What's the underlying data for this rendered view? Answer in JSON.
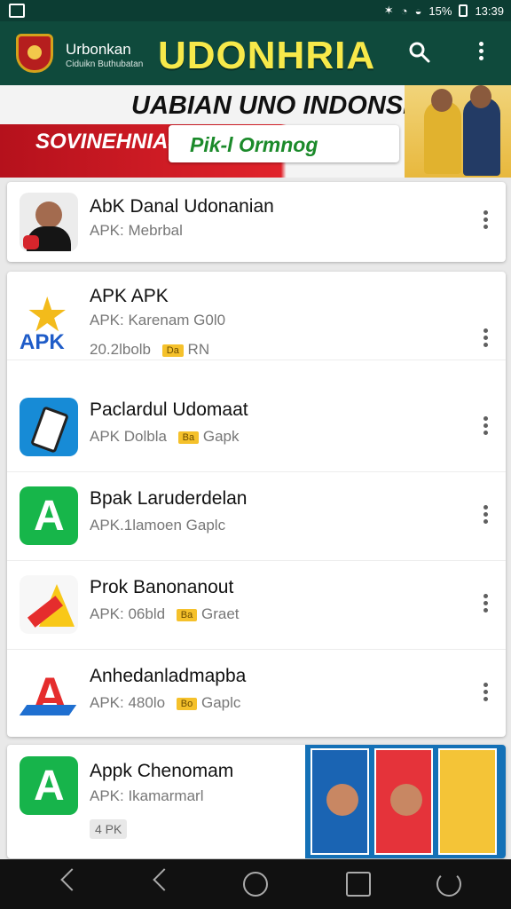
{
  "status": {
    "time": "13:39",
    "battery_text": "15%"
  },
  "header": {
    "brand_main": "Urbonkan",
    "brand_sub": "Ciduikn Buthubatan",
    "title": "UDONHRIA"
  },
  "banner": {
    "title": "UABIAN UNO INDONSIAI",
    "sub": "SOVINEHNIAS!",
    "input_text": "Pik-l Ormnog"
  },
  "featured": {
    "name": "AbK Danal Udonanian",
    "meta": "APK: Mebrbal"
  },
  "apps": [
    {
      "name": "APK APK",
      "meta": "APK: Karenam G0l0",
      "meta2": "20.2lbolb",
      "tag": "Da",
      "tag2": "RN"
    },
    {
      "name": "Paclardul Udomaat",
      "meta": "APK Dolbla",
      "tag": "Ba",
      "tag2": "Gapk"
    },
    {
      "name": "Bpak Laruderdelan",
      "meta": "APK.1lamoen Gaplc",
      "tag": "",
      "tag2": ""
    },
    {
      "name": "Prok Banonanout",
      "meta": "APK: 06bld",
      "tag": "Ba",
      "tag2": "Graet"
    },
    {
      "name": "Anhedanladmapba",
      "meta": "APK: 480lo",
      "tag": "Bo",
      "tag2": "Gaplc"
    }
  ],
  "bottom_app": {
    "name": "Appk Chenomam",
    "meta": "APK: Ikamarmarl",
    "badge": "4 PK"
  },
  "icons": [
    "search-icon",
    "more-vert-icon",
    "heart-icon",
    "star-icon",
    "back-icon",
    "home-icon",
    "recent-apps-icon",
    "refresh-icon"
  ]
}
